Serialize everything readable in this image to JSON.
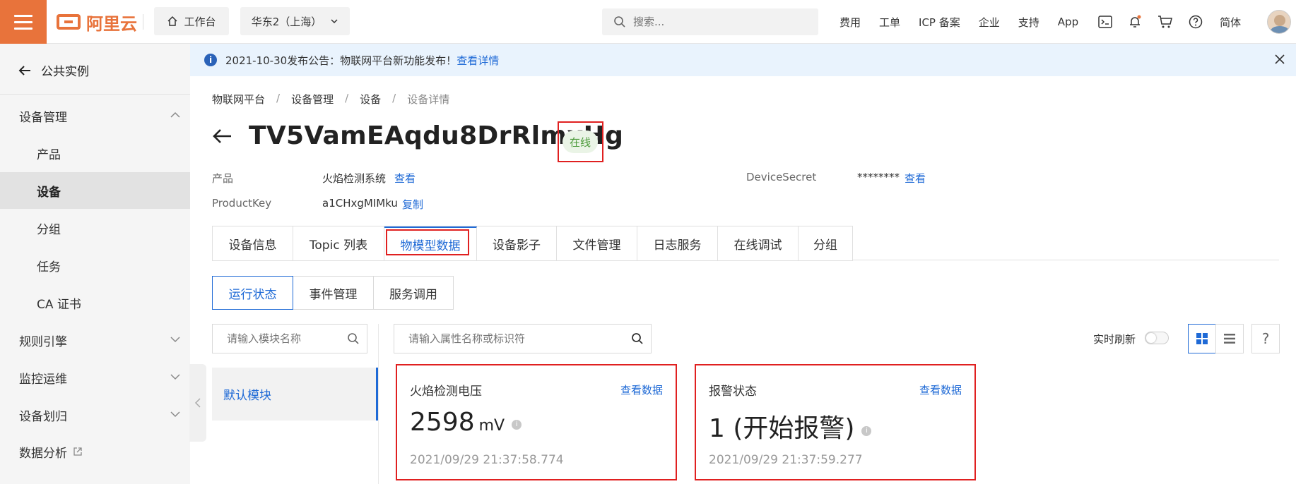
{
  "topbar": {
    "logo_text": "阿里云",
    "workbench": "工作台",
    "region": "华东2（上海）",
    "search_placeholder": "搜索...",
    "nav": [
      "费用",
      "工单",
      "ICP 备案",
      "企业",
      "支持",
      "App"
    ],
    "lang": "简体",
    "accent": "#e8733b"
  },
  "sidebar": {
    "back_label": "公共实例",
    "groups": [
      {
        "label": "设备管理",
        "expanded": true
      },
      {
        "label": "规则引擎",
        "expanded": false
      },
      {
        "label": "监控运维",
        "expanded": false
      },
      {
        "label": "设备划归",
        "expanded": false
      },
      {
        "label": "数据分析",
        "external": true
      }
    ],
    "sub_items": [
      "产品",
      "设备",
      "分组",
      "任务",
      "CA 证书"
    ],
    "active_item": "设备"
  },
  "notice": {
    "text": "2021-10-30发布公告：物联网平台新功能发布！",
    "link": "查看详情"
  },
  "breadcrumb": [
    "物联网平台",
    "设备管理",
    "设备",
    "设备详情"
  ],
  "device": {
    "name": "TV5VamEAqdu8DrRlmxHg",
    "status": "在线",
    "product_label": "产品",
    "product_value": "火焰检测系统",
    "product_link": "查看",
    "productkey_label": "ProductKey",
    "productkey_value": "a1CHxgMIMku",
    "productkey_link": "复制",
    "secret_label": "DeviceSecret",
    "secret_value": "********",
    "secret_link": "查看"
  },
  "tabs": [
    "设备信息",
    "Topic 列表",
    "物模型数据",
    "设备影子",
    "文件管理",
    "日志服务",
    "在线调试",
    "分组"
  ],
  "active_tab": "物模型数据",
  "subtabs": [
    "运行状态",
    "事件管理",
    "服务调用"
  ],
  "active_subtab": "运行状态",
  "module_search_placeholder": "请输入模块名称",
  "attr_search_placeholder": "请输入属性名称或标识符",
  "module_default": "默认模块",
  "realtime_label": "实时刷新",
  "realtime_on": false,
  "cards": [
    {
      "title": "火焰检测电压",
      "link": "查看数据",
      "value": "2598",
      "unit": "mV",
      "time": "2021/09/29 21:37:58.774"
    },
    {
      "title": "报警状态",
      "link": "查看数据",
      "value": "1 (开始报警)",
      "unit": "",
      "time": "2021/09/29 21:37:59.277"
    }
  ]
}
